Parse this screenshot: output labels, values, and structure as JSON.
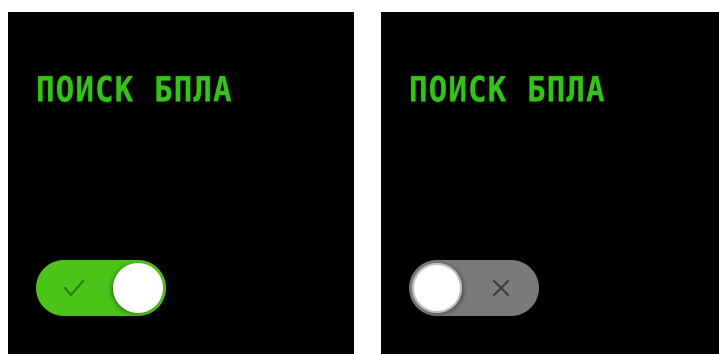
{
  "panels": [
    {
      "title": "ПОИСК БПЛА",
      "toggle": {
        "state": "on",
        "icon": "check-icon"
      }
    },
    {
      "title": "ПОИСК БПЛА",
      "toggle": {
        "state": "off",
        "icon": "x-icon"
      }
    }
  ],
  "colors": {
    "background": "#000000",
    "title_green": "#35c319",
    "toggle_on": "#4cc51a",
    "toggle_off": "#7a7a7a",
    "knob": "#ffffff"
  }
}
